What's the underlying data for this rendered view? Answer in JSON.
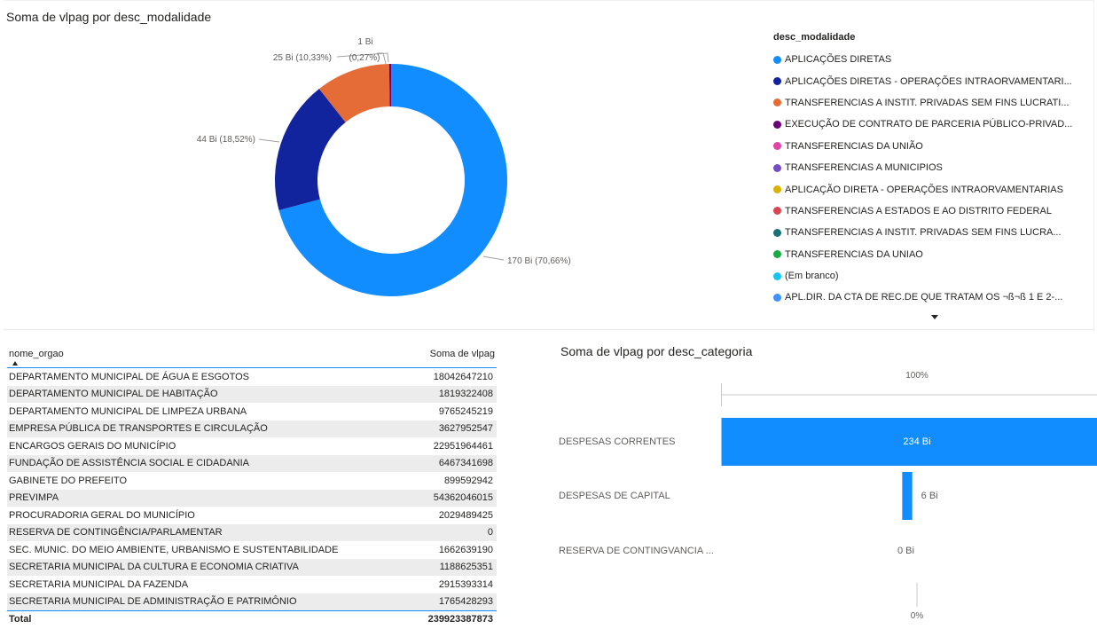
{
  "donut": {
    "title": "Soma de vlpag por desc_modalidade",
    "chart_data": {
      "type": "pie",
      "title": "Soma de vlpag por desc_modalidade",
      "legend_title": "desc_modalidade",
      "legend_position": "right",
      "slices": [
        {
          "label": "APLICAÇÕES DIRETAS",
          "value": 170,
          "percent": 70.66,
          "data_label": "170 Bi (70,66%)",
          "color": "#118dff"
        },
        {
          "label": "APLICAÇÕES DIRETAS - OPERAÇÕES INTRAORVAMENTARI...",
          "value": 44,
          "percent": 18.52,
          "data_label": "44 Bi (18,52%)",
          "color": "#12239e"
        },
        {
          "label": "TRANSFERENCIAS A INSTIT. PRIVADAS SEM FINS LUCRATI...",
          "value": 25,
          "percent": 10.33,
          "data_label": "25 Bi (10,33%)",
          "color": "#e66c37"
        },
        {
          "label": "EXECUÇÃO DE CONTRATO DE PARCERIA PÚBLICO-PRIVAD...",
          "value": 1,
          "percent": 0.27,
          "data_label": "1 Bi (0,27%)",
          "color": "#6b007b"
        },
        {
          "label": "TRANSFERENCIAS DA UNIÃO",
          "value": 0,
          "percent": 0,
          "data_label": "",
          "color": "#e044a7"
        },
        {
          "label": "TRANSFERENCIAS A MUNICIPIOS",
          "value": 0,
          "percent": 0,
          "data_label": "",
          "color": "#744ec2"
        },
        {
          "label": "APLICAÇÃO DIRETA - OPERAÇÕES INTRAORVAMENTARIAS",
          "value": 0,
          "percent": 0,
          "data_label": "",
          "color": "#d9b300"
        },
        {
          "label": "TRANSFERENCIAS A ESTADOS E AO DISTRITO FEDERAL",
          "value": 0,
          "percent": 0,
          "data_label": "",
          "color": "#d64550"
        },
        {
          "label": "TRANSFERENCIAS A INSTIT.  PRIVADAS  SEM  FINS LUCRA...",
          "value": 0,
          "percent": 0,
          "data_label": "",
          "color": "#197278"
        },
        {
          "label": "TRANSFERENCIAS DA UNIAO",
          "value": 0,
          "percent": 0,
          "data_label": "",
          "color": "#1aab40"
        },
        {
          "label": "(Em branco)",
          "value": 0,
          "percent": 0,
          "data_label": "",
          "color": "#15c6f4"
        },
        {
          "label": "APL.DIR. DA CTA DE REC.DE QUE TRATAM OS ¬ß¬ß 1 E 2-...",
          "value": 0,
          "percent": 0,
          "data_label": "",
          "color": "#4092ff"
        }
      ]
    }
  },
  "table": {
    "col1": "nome_orgao",
    "col2": "Soma de vlpag",
    "rows": [
      [
        "DEPARTAMENTO MUNICIPAL DE ÁGUA E ESGOTOS",
        "18042647210"
      ],
      [
        "DEPARTAMENTO MUNICIPAL DE HABITAÇÃO",
        "1819322408"
      ],
      [
        "DEPARTAMENTO MUNICIPAL DE LIMPEZA URBANA",
        "9765245219"
      ],
      [
        "EMPRESA PÚBLICA DE TRANSPORTES E CIRCULAÇÃO",
        "3627952547"
      ],
      [
        "ENCARGOS GERAIS DO MUNICÍPIO",
        "22951964461"
      ],
      [
        "FUNDAÇÃO DE ASSISTÊNCIA SOCIAL E CIDADANIA",
        "6467341698"
      ],
      [
        "GABINETE DO PREFEITO",
        "899592942"
      ],
      [
        "PREVIMPA",
        "54362046015"
      ],
      [
        "PROCURADORIA GERAL DO MUNICÍPIO",
        "2029489425"
      ],
      [
        "RESERVA DE CONTINGÊNCIA/PARLAMENTAR",
        "0"
      ],
      [
        "SEC. MUNIC. DO MEIO AMBIENTE, URBANISMO E SUSTENTABILIDADE",
        "1662639190"
      ],
      [
        "SECRETARIA MUNICIPAL DA CULTURA E ECONOMIA CRIATIVA",
        "1188625351"
      ],
      [
        "SECRETARIA MUNICIPAL DA FAZENDA",
        "2915393314"
      ],
      [
        "SECRETARIA MUNICIPAL DE ADMINISTRAÇÃO E PATRIMÔNIO",
        "1765428293"
      ]
    ],
    "total_label": "Total",
    "total_value": "239923387873"
  },
  "funnel": {
    "title": "Soma de vlpag por desc_categoria",
    "top_label": "100%",
    "bottom_label": "0%",
    "chart_data": {
      "type": "bar",
      "title": "Soma de vlpag por desc_categoria",
      "categories": [
        "DESPESAS CORRENTES",
        "DESPESAS DE CAPITAL",
        "RESERVA DE CONTINGVANCIA ..."
      ],
      "values": [
        234,
        6,
        0
      ],
      "data_labels": [
        "234 Bi",
        "6 Bi",
        "0 Bi"
      ],
      "color": "#118dff"
    }
  }
}
